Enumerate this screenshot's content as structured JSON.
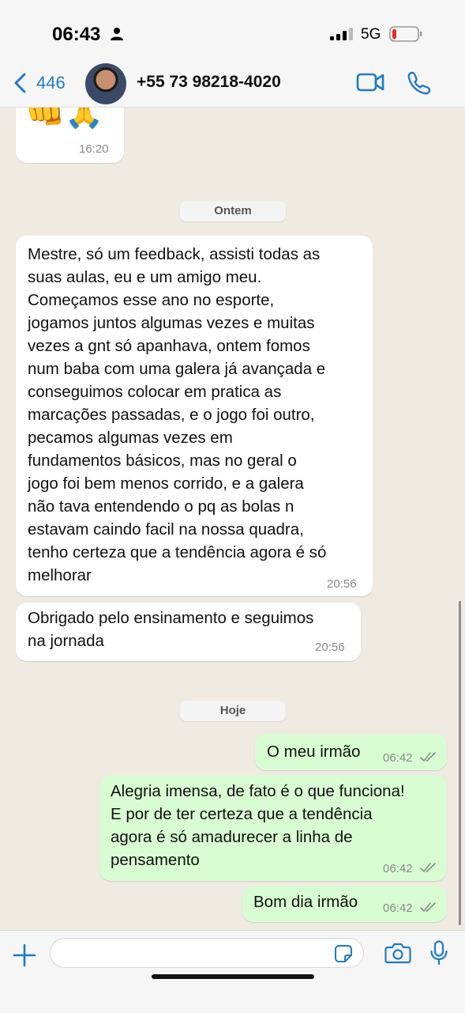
{
  "status_bar": {
    "time": "06:43",
    "network": "5G"
  },
  "header": {
    "back_count": "446",
    "contact_name": "+55 73 98218-4020"
  },
  "chat": {
    "first_partial": {
      "emoji": "👊🙏",
      "time": "16:20"
    },
    "date_dividers": [
      "Ontem",
      "Hoje"
    ],
    "incoming": [
      {
        "lines": [
          "Mestre, só um feedback, assisti todas as",
          "suas aulas, eu e um amigo meu.",
          "Começamos esse ano no esporte,",
          "jogamos juntos algumas vezes e muitas",
          "vezes a gnt só apanhava, ontem fomos",
          "num baba com uma galera já avançada e",
          "conseguimos colocar em pratica as",
          "marcações passadas, e o jogo foi outro,",
          "pecamos algumas vezes em",
          "fundamentos básicos, mas no geral o",
          "jogo foi bem menos corrido, e a galera",
          "não tava entendendo o pq as bolas n",
          "estavam caindo facil na nossa quadra,",
          "tenho certeza que a tendência agora é só",
          "melhorar"
        ],
        "time": "20:56"
      },
      {
        "lines": [
          "Obrigado pelo ensinamento e seguimos",
          "na jornada"
        ],
        "time": "20:56"
      }
    ],
    "outgoing": [
      {
        "lines": [
          "O meu irmão"
        ],
        "time": "06:42"
      },
      {
        "lines": [
          "Alegria imensa, de fato é o que funciona!",
          "E por de ter certeza que a tendência",
          "agora é só amadurecer a linha de",
          "pensamento"
        ],
        "time": "06:42"
      },
      {
        "lines": [
          "Bom dia irmão"
        ],
        "time": "06:42"
      }
    ]
  },
  "colors": {
    "accent": "#1f7ac8",
    "outgoing_bubble": "#d9fdd3",
    "incoming_bubble": "#ffffff",
    "wallpaper": "#efeae2"
  }
}
